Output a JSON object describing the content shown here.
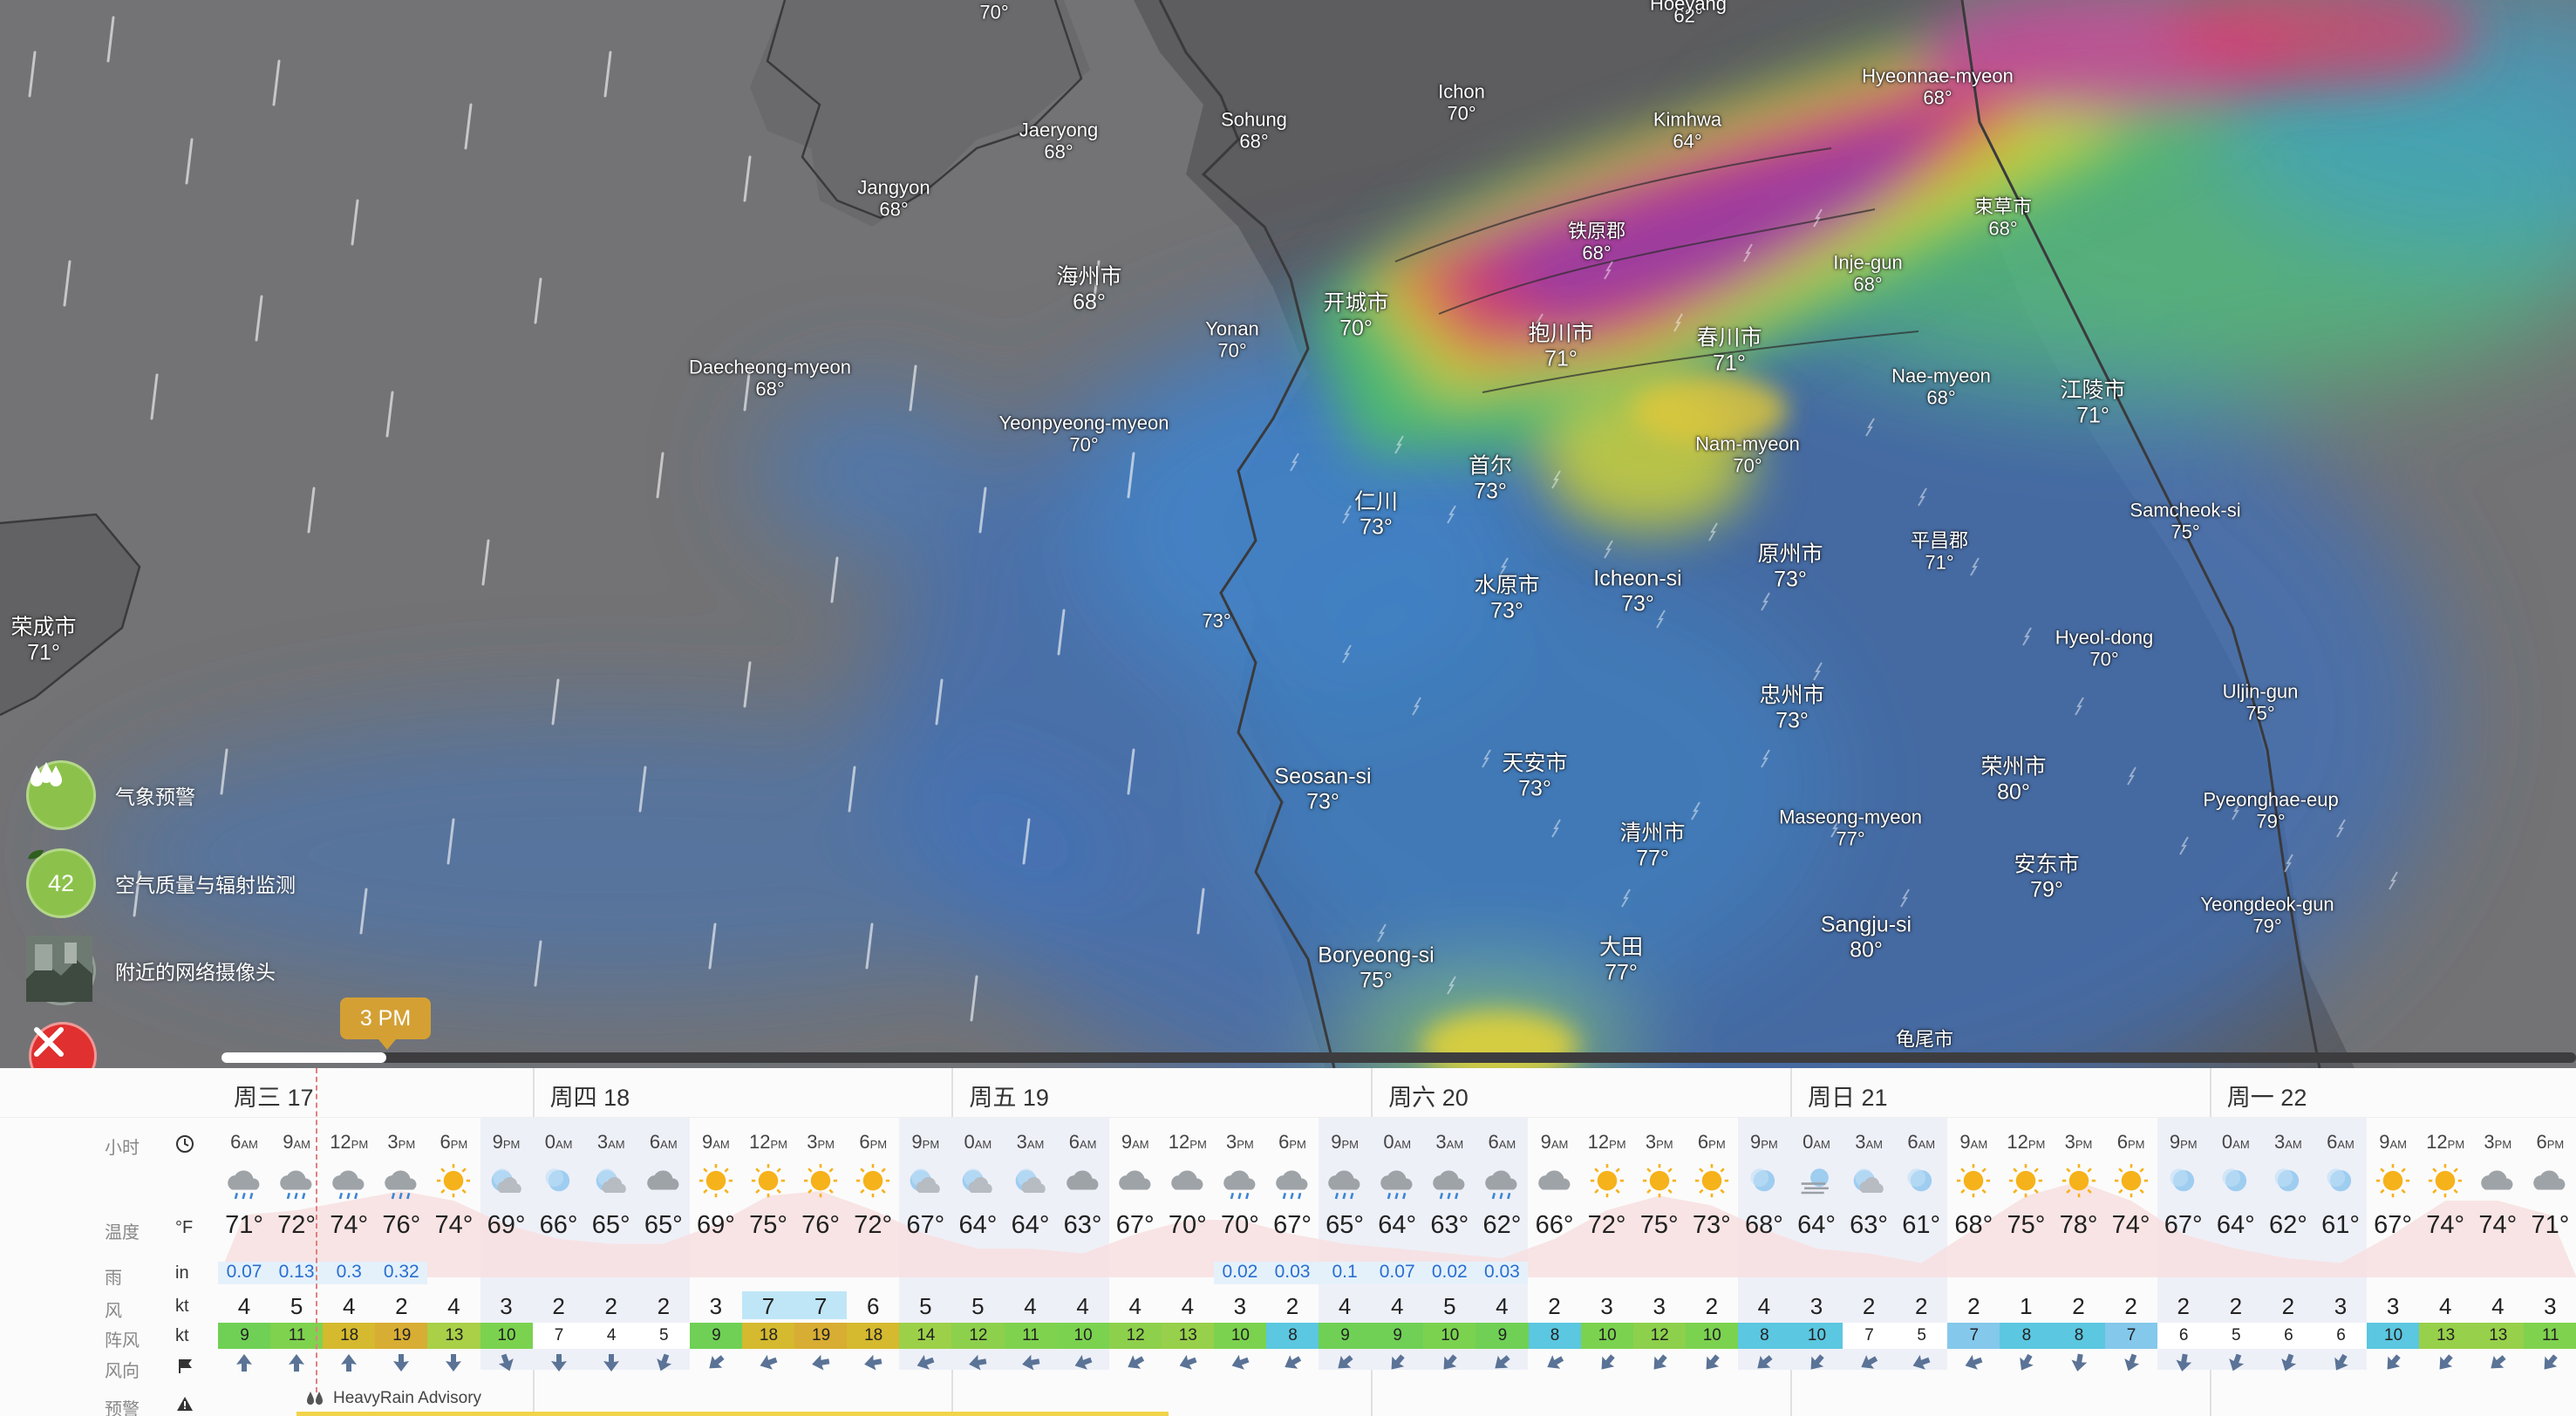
{
  "map": {
    "cities": [
      {
        "name": "",
        "temp": "70°"
      },
      {
        "name": "",
        "temp": "62°"
      },
      {
        "name": "Hoeyang",
        "temp": ""
      },
      {
        "name": "Ichon",
        "temp": "70°"
      },
      {
        "name": "Sohung",
        "temp": "68°"
      },
      {
        "name": "Jaeryong",
        "temp": "68°"
      },
      {
        "name": "Jangyon",
        "temp": "68°"
      },
      {
        "name": "Kimhwa",
        "temp": "64°"
      },
      {
        "name": "Hyeonnae-myeon",
        "temp": "68°"
      },
      {
        "name": "束草市",
        "temp": "68°"
      },
      {
        "name": "铁原郡",
        "temp": "68°"
      },
      {
        "name": "Inje-gun",
        "temp": "68°"
      },
      {
        "name": "海州市",
        "temp": "68°"
      },
      {
        "name": "开城市",
        "temp": "70°"
      },
      {
        "name": "Yonan",
        "temp": "70°"
      },
      {
        "name": "抱川市",
        "temp": "71°"
      },
      {
        "name": "春川市",
        "temp": "71°"
      },
      {
        "name": "Daecheong-myeon",
        "temp": "68°"
      },
      {
        "name": "Nae-myeon",
        "temp": "68°"
      },
      {
        "name": "江陵市",
        "temp": "71°"
      },
      {
        "name": "Yeonpyeong-myeon",
        "temp": "70°"
      },
      {
        "name": "Nam-myeon",
        "temp": "70°"
      },
      {
        "name": "首尔",
        "temp": "73°"
      },
      {
        "name": "仁川",
        "temp": "73°"
      },
      {
        "name": "Samcheok-si",
        "temp": "75°"
      },
      {
        "name": "平昌郡",
        "temp": "71°"
      },
      {
        "name": "原州市",
        "temp": "73°"
      },
      {
        "name": "水原市",
        "temp": "73°"
      },
      {
        "name": "Icheon-si",
        "temp": "73°"
      },
      {
        "name": "荣成市",
        "temp": "71°"
      },
      {
        "name": "",
        "temp": "73°"
      },
      {
        "name": "Hyeol-dong",
        "temp": "70°"
      },
      {
        "name": "Uljin-gun",
        "temp": "75°"
      },
      {
        "name": "忠州市",
        "temp": "73°"
      },
      {
        "name": "天安市",
        "temp": "73°"
      },
      {
        "name": "荣州市",
        "temp": "80°"
      },
      {
        "name": "Seosan-si",
        "temp": "73°"
      },
      {
        "name": "Pyeonghae-eup",
        "temp": "79°"
      },
      {
        "name": "Maseong-myeon",
        "temp": "77°"
      },
      {
        "name": "清州市",
        "temp": "77°"
      },
      {
        "name": "安东市",
        "temp": "79°"
      },
      {
        "name": "Yeongdeok-gun",
        "temp": "79°"
      },
      {
        "name": "Sangju-si",
        "temp": "80°"
      },
      {
        "name": "大田",
        "temp": "77°"
      },
      {
        "name": "Boryeong-si",
        "temp": "75°"
      },
      {
        "name": "龟尾市",
        "temp": ""
      }
    ]
  },
  "layers": [
    {
      "label": "气象预警",
      "icon": "rain-drops-icon"
    },
    {
      "label": "空气质量与辐射监测",
      "value": "42",
      "icon": "leaf-icon"
    },
    {
      "label": "附近的网络摄像头",
      "icon": "webcam-thumbnail-icon"
    }
  ],
  "timeline": {
    "current": "3 PM",
    "progress_fraction": 0.07
  },
  "forecast": {
    "row_labels": {
      "hour": "小时",
      "temp": "温度",
      "rain": "雨",
      "wind": "风",
      "gust": "阵风",
      "dir": "风向",
      "warn": "预警"
    },
    "units": {
      "temp": "°F",
      "rain": "in",
      "wind": "kt",
      "gust": "kt"
    },
    "warning_text": "HeavyRain Advisory",
    "days": [
      "周三 17",
      "周四 18",
      "周五 19",
      "周六 20",
      "周日 21",
      "周一 22"
    ],
    "hours": [
      "6",
      "9",
      "12",
      "3",
      "6",
      "9",
      "0",
      "3",
      "6",
      "9",
      "12",
      "3",
      "6",
      "9",
      "0",
      "3",
      "6",
      "9",
      "12",
      "3",
      "6",
      "9",
      "0",
      "3",
      "6",
      "9",
      "12",
      "3",
      "6",
      "9",
      "0",
      "3",
      "6",
      "9",
      "12",
      "3",
      "6",
      "9",
      "0",
      "3",
      "6",
      "9",
      "12",
      "3",
      "6"
    ],
    "ampm": [
      "AM",
      "AM",
      "PM",
      "PM",
      "PM",
      "PM",
      "AM",
      "AM",
      "AM",
      "AM",
      "PM",
      "PM",
      "PM",
      "PM",
      "AM",
      "AM",
      "AM",
      "AM",
      "PM",
      "PM",
      "PM",
      "PM",
      "AM",
      "AM",
      "AM",
      "AM",
      "PM",
      "PM",
      "PM",
      "PM",
      "AM",
      "AM",
      "AM",
      "AM",
      "PM",
      "PM",
      "PM",
      "PM",
      "AM",
      "AM",
      "AM",
      "AM",
      "PM",
      "PM",
      "PM"
    ],
    "weather": [
      "rain",
      "rain",
      "rain",
      "rain",
      "sun",
      "night-cloud",
      "moon",
      "night-cloud",
      "cloud",
      "sun",
      "sun",
      "sun",
      "sun",
      "night-cloud",
      "night-cloud",
      "night-cloud",
      "cloud",
      "cloud",
      "cloud",
      "rain",
      "rain",
      "rain",
      "rain",
      "rain",
      "rain",
      "cloud",
      "sun",
      "sun",
      "sun",
      "moon",
      "fog",
      "night-cloud",
      "moon",
      "sun",
      "sun",
      "sun",
      "sun",
      "moon",
      "moon",
      "moon",
      "moon",
      "sun",
      "sun",
      "cloud",
      "cloud"
    ],
    "temps": [
      "71°",
      "72°",
      "74°",
      "76°",
      "74°",
      "69°",
      "66°",
      "65°",
      "65°",
      "69°",
      "75°",
      "76°",
      "72°",
      "67°",
      "64°",
      "64°",
      "63°",
      "67°",
      "70°",
      "70°",
      "67°",
      "65°",
      "64°",
      "63°",
      "62°",
      "66°",
      "72°",
      "75°",
      "73°",
      "68°",
      "64°",
      "63°",
      "61°",
      "68°",
      "75°",
      "78°",
      "74°",
      "67°",
      "64°",
      "62°",
      "61°",
      "67°",
      "74°",
      "74°",
      "71°"
    ],
    "rain": [
      "0.07",
      "0.13",
      "0.3",
      "0.32",
      "",
      "",
      "",
      "",
      "",
      "",
      "",
      "",
      "",
      "",
      "",
      "",
      "",
      "",
      "",
      "0.02",
      "0.03",
      "0.1",
      "0.07",
      "0.02",
      "0.03",
      "",
      "",
      "",
      "",
      "",
      "",
      "",
      "",
      "",
      "",
      "",
      "",
      "",
      "",
      "",
      "",
      "",
      "",
      "",
      ""
    ],
    "wind": [
      "4",
      "5",
      "4",
      "2",
      "4",
      "3",
      "2",
      "2",
      "2",
      "3",
      "7",
      "7",
      "6",
      "5",
      "5",
      "4",
      "4",
      "4",
      "4",
      "3",
      "2",
      "4",
      "4",
      "5",
      "4",
      "2",
      "3",
      "3",
      "2",
      "4",
      "3",
      "2",
      "2",
      "2",
      "1",
      "2",
      "2",
      "2",
      "2",
      "2",
      "3",
      "3",
      "4",
      "4",
      "3"
    ],
    "gust": [
      "9",
      "11",
      "18",
      "19",
      "13",
      "10",
      "7",
      "4",
      "5",
      "9",
      "18",
      "19",
      "18",
      "14",
      "12",
      "11",
      "10",
      "12",
      "13",
      "10",
      "8",
      "9",
      "9",
      "10",
      "9",
      "8",
      "10",
      "12",
      "10",
      "8",
      "10",
      "7",
      "5",
      "7",
      "8",
      "8",
      "7",
      "6",
      "5",
      "6",
      "6",
      "10",
      "13",
      "13",
      "11"
    ],
    "gust_colors": [
      "#6fd055",
      "#7fd24e",
      "#d5b92e",
      "#d8ad33",
      "#a9d047",
      "#7bd24f",
      "#ffffff",
      "#ffffff",
      "#ffffff",
      "#6fd055",
      "#d5b92e",
      "#d8ad33",
      "#d5b92e",
      "#9cd048",
      "#8dd04c",
      "#7fd24e",
      "#7bd24f",
      "#8dd04c",
      "#97d04a",
      "#7bd24f",
      "#5bc7e0",
      "#6fd055",
      "#6fd055",
      "#7bd24f",
      "#6fd055",
      "#5bc7e0",
      "#7bd24f",
      "#8dd04c",
      "#7bd24f",
      "#5bc7e0",
      "#5bc7e0",
      "#ffffff",
      "#ffffff",
      "#84c8ec",
      "#5bc7e0",
      "#5bc7e0",
      "#84c8ec",
      "#ffffff",
      "#ffffff",
      "#ffffff",
      "#ffffff",
      "#5bc7e0",
      "#97d04a",
      "#97d04a",
      "#7fd24e"
    ],
    "wind_dir_deg": [
      0,
      0,
      0,
      180,
      180,
      160,
      180,
      180,
      200,
      230,
      250,
      260,
      260,
      250,
      260,
      260,
      250,
      240,
      250,
      250,
      240,
      230,
      220,
      220,
      230,
      240,
      220,
      220,
      220,
      230,
      220,
      240,
      250,
      250,
      210,
      190,
      200,
      190,
      200,
      200,
      210,
      220,
      220,
      230,
      220
    ]
  }
}
